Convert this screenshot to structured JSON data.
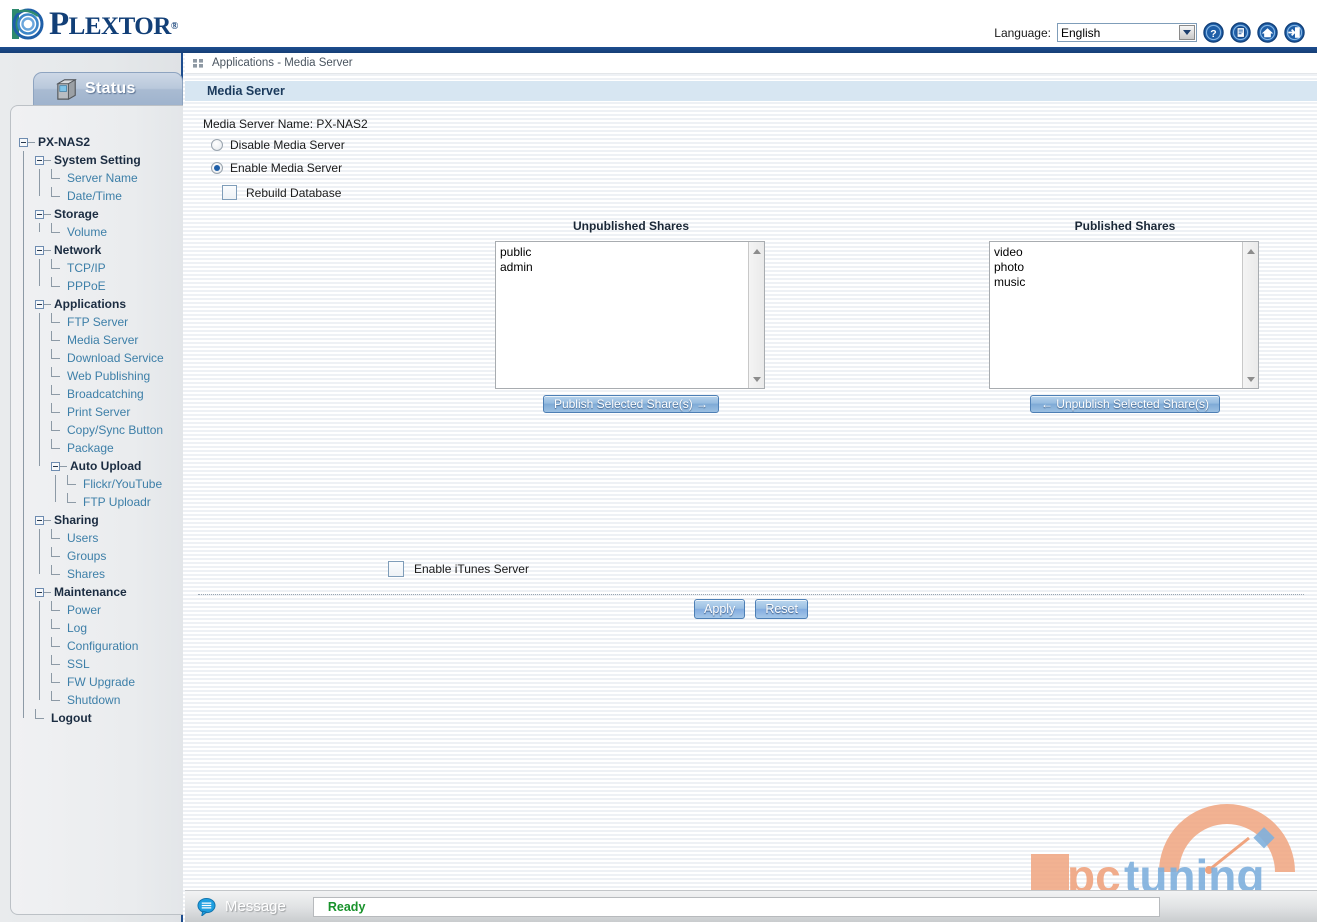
{
  "brand": {
    "name_cap": "P",
    "name_rest": "LEXTOR",
    "trademark": "®",
    "logo_icon": "plextor-spiral-logo"
  },
  "header": {
    "language_label": "Language:",
    "language_value": "English",
    "icons": [
      {
        "name": "help-icon",
        "glyph": "?"
      },
      {
        "name": "notes-icon",
        "glyph": "document"
      },
      {
        "name": "home-icon",
        "glyph": "home"
      },
      {
        "name": "logout-icon",
        "glyph": "exit"
      }
    ]
  },
  "sidebar": {
    "tab_label": "Status",
    "tab_icon": "server-box-icon",
    "tree": [
      {
        "label": "PX-NAS2",
        "depth": 0,
        "bold": true,
        "toggle": "minus"
      },
      {
        "label": "System Setting",
        "depth": 1,
        "bold": true,
        "toggle": "minus"
      },
      {
        "label": "Server Name",
        "depth": 2,
        "bold": false,
        "toggle": "none"
      },
      {
        "label": "Date/Time",
        "depth": 2,
        "bold": false,
        "toggle": "none"
      },
      {
        "label": "Storage",
        "depth": 1,
        "bold": true,
        "toggle": "minus"
      },
      {
        "label": "Volume",
        "depth": 2,
        "bold": false,
        "toggle": "none"
      },
      {
        "label": "Network",
        "depth": 1,
        "bold": true,
        "toggle": "minus"
      },
      {
        "label": "TCP/IP",
        "depth": 2,
        "bold": false,
        "toggle": "none"
      },
      {
        "label": "PPPoE",
        "depth": 2,
        "bold": false,
        "toggle": "none"
      },
      {
        "label": "Applications",
        "depth": 1,
        "bold": true,
        "toggle": "minus"
      },
      {
        "label": "FTP Server",
        "depth": 2,
        "bold": false,
        "toggle": "none"
      },
      {
        "label": "Media Server",
        "depth": 2,
        "bold": false,
        "toggle": "none"
      },
      {
        "label": "Download Service",
        "depth": 2,
        "bold": false,
        "toggle": "none"
      },
      {
        "label": "Web Publishing",
        "depth": 2,
        "bold": false,
        "toggle": "none"
      },
      {
        "label": "Broadcatching",
        "depth": 2,
        "bold": false,
        "toggle": "none"
      },
      {
        "label": "Print Server",
        "depth": 2,
        "bold": false,
        "toggle": "none"
      },
      {
        "label": "Copy/Sync Button",
        "depth": 2,
        "bold": false,
        "toggle": "none"
      },
      {
        "label": "Package",
        "depth": 2,
        "bold": false,
        "toggle": "none"
      },
      {
        "label": "Auto Upload",
        "depth": 2,
        "bold": true,
        "toggle": "minus"
      },
      {
        "label": "Flickr/YouTube",
        "depth": 3,
        "bold": false,
        "toggle": "none"
      },
      {
        "label": "FTP Uploadr",
        "depth": 3,
        "bold": false,
        "toggle": "none"
      },
      {
        "label": "Sharing",
        "depth": 1,
        "bold": true,
        "toggle": "minus"
      },
      {
        "label": "Users",
        "depth": 2,
        "bold": false,
        "toggle": "none"
      },
      {
        "label": "Groups",
        "depth": 2,
        "bold": false,
        "toggle": "none"
      },
      {
        "label": "Shares",
        "depth": 2,
        "bold": false,
        "toggle": "none"
      },
      {
        "label": "Maintenance",
        "depth": 1,
        "bold": true,
        "toggle": "minus"
      },
      {
        "label": "Power",
        "depth": 2,
        "bold": false,
        "toggle": "none"
      },
      {
        "label": "Log",
        "depth": 2,
        "bold": false,
        "toggle": "none"
      },
      {
        "label": "Configuration",
        "depth": 2,
        "bold": false,
        "toggle": "none"
      },
      {
        "label": "SSL",
        "depth": 2,
        "bold": false,
        "toggle": "none"
      },
      {
        "label": "FW Upgrade",
        "depth": 2,
        "bold": false,
        "toggle": "none"
      },
      {
        "label": "Shutdown",
        "depth": 2,
        "bold": false,
        "toggle": "none"
      },
      {
        "label": "Logout",
        "depth": 1,
        "bold": true,
        "toggle": "none"
      }
    ]
  },
  "breadcrumb": {
    "icon": "grid-dots-icon",
    "text": "Applications - Media Server"
  },
  "section": {
    "title": "Media Server"
  },
  "form": {
    "server_name_line": "Media Server Name: PX-NAS2",
    "radio_disable": "Disable Media Server",
    "radio_enable": "Enable Media Server",
    "radio_selected": "enable",
    "rebuild_label": "Rebuild Database",
    "rebuild_checked": false,
    "itunes_label": "Enable iTunes Server",
    "itunes_checked": false
  },
  "shares": {
    "unpublished_title": "Unpublished Shares",
    "unpublished_items": [
      "public",
      "admin"
    ],
    "publish_button": "Publish Selected Share(s) →",
    "published_title": "Published Shares",
    "published_items": [
      "video",
      "photo",
      "music"
    ],
    "unpublish_button": "← Unpublish Selected Share(s)"
  },
  "actions": {
    "apply": "Apply",
    "reset": "Reset"
  },
  "statusbar": {
    "icon": "message-bubble-icon",
    "label": "Message",
    "value": "Ready"
  },
  "watermark": {
    "text_pc": "pc",
    "text_tuning": "tuning"
  },
  "colors": {
    "brand_blue": "#163f76",
    "accent_blue": "#1d4d8f",
    "section_bg": "#d7e6f2",
    "link": "#3d7fa8",
    "ready_green": "#18922b"
  }
}
